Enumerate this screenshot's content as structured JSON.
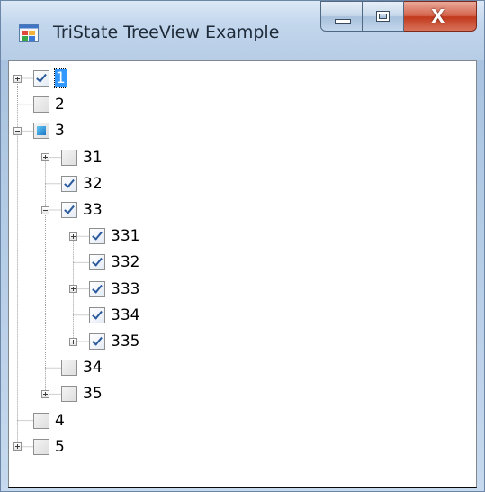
{
  "window": {
    "title": "TriState TreeView Example",
    "close_glyph": "X"
  },
  "tree": {
    "nodes": [
      {
        "label": "1",
        "state": "checked",
        "expander": "plus",
        "selected": true
      },
      {
        "label": "2",
        "state": "unchecked",
        "expander": "none",
        "selected": false
      },
      {
        "label": "3",
        "state": "partial",
        "expander": "minus",
        "selected": false
      },
      {
        "label": "31",
        "state": "unchecked",
        "expander": "plus",
        "selected": false
      },
      {
        "label": "32",
        "state": "checked",
        "expander": "none",
        "selected": false
      },
      {
        "label": "33",
        "state": "checked",
        "expander": "minus",
        "selected": false
      },
      {
        "label": "331",
        "state": "checked",
        "expander": "plus",
        "selected": false
      },
      {
        "label": "332",
        "state": "checked",
        "expander": "none",
        "selected": false
      },
      {
        "label": "333",
        "state": "checked",
        "expander": "plus",
        "selected": false
      },
      {
        "label": "334",
        "state": "checked",
        "expander": "none",
        "selected": false
      },
      {
        "label": "335",
        "state": "checked",
        "expander": "plus",
        "selected": false
      },
      {
        "label": "34",
        "state": "unchecked",
        "expander": "none",
        "selected": false
      },
      {
        "label": "35",
        "state": "unchecked",
        "expander": "plus",
        "selected": false
      },
      {
        "label": "4",
        "state": "unchecked",
        "expander": "none",
        "selected": false
      },
      {
        "label": "5",
        "state": "unchecked",
        "expander": "plus",
        "selected": false
      }
    ]
  },
  "colors": {
    "selection": "#3399ff",
    "checkmark": "#2a5a9c",
    "partial_fill": "#1e78c8",
    "close_button": "#c1391c"
  },
  "icons": {
    "app": "app-icon",
    "minimize": "minimize-icon",
    "maximize": "maximize-icon",
    "close": "close-icon"
  }
}
